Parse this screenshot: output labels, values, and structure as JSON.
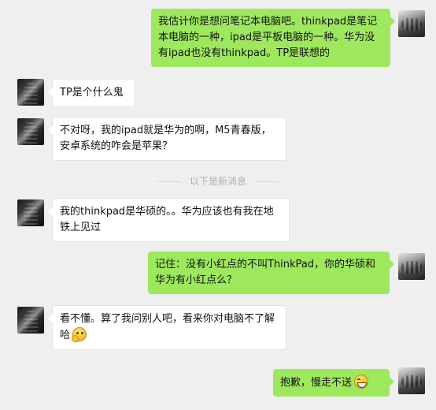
{
  "messages": [
    {
      "side": "out",
      "text": "我估计你是想问笔记本电脑吧。thinkpad是笔记本电脑的一种，ipad是平板电脑的一种。华为没有ipad也没有thinkpad。TP是联想的"
    },
    {
      "side": "in",
      "text": "TP是个什么鬼"
    },
    {
      "side": "in",
      "text": "不对呀，我的ipad就是华为的啊，M5青春版，安卓系统的咋会是苹果？"
    },
    {
      "side": "in",
      "text": "我的thinkpad是华硕的。。华为应该也有我在地铁上见过"
    },
    {
      "side": "out",
      "text": "记住：没有小红点的不叫ThinkPad，你的华硕和华为有小红点么？"
    },
    {
      "side": "in",
      "text": "看不懂。算了我问别人吧，看来你对电脑不了解哈",
      "emoji": "thinking-emoji"
    },
    {
      "side": "out",
      "text": "抱歉，慢走不送",
      "emoji": "grin-emoji"
    }
  ],
  "divider": {
    "text": "以下是新消息"
  },
  "colors": {
    "outgoing_bubble": "#9ee85e",
    "incoming_bubble": "#ffffff",
    "background": "#efefef"
  }
}
